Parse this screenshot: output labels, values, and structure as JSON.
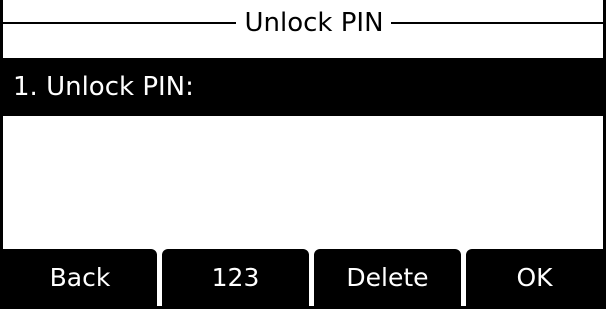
{
  "title": "Unlock PIN",
  "list": {
    "items": [
      {
        "label": "1. Unlock PIN:",
        "selected": true
      }
    ]
  },
  "softkeys": [
    {
      "label": "Back"
    },
    {
      "label": "123"
    },
    {
      "label": "Delete"
    },
    {
      "label": "OK"
    }
  ],
  "colors": {
    "background": "#ffffff",
    "foreground": "#000000",
    "highlight_text": "#ffffff"
  }
}
